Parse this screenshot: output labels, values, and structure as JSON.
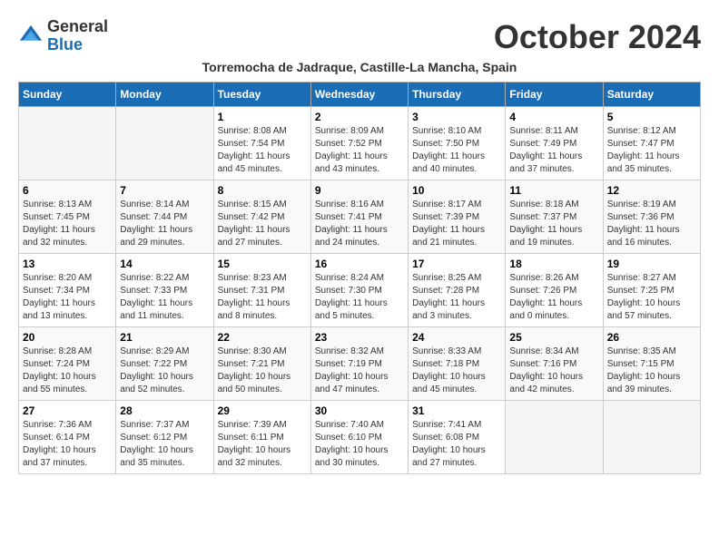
{
  "header": {
    "logo_general": "General",
    "logo_blue": "Blue",
    "month_title": "October 2024",
    "location": "Torremocha de Jadraque, Castille-La Mancha, Spain"
  },
  "weekdays": [
    "Sunday",
    "Monday",
    "Tuesday",
    "Wednesday",
    "Thursday",
    "Friday",
    "Saturday"
  ],
  "weeks": [
    [
      {
        "day": "",
        "info": ""
      },
      {
        "day": "",
        "info": ""
      },
      {
        "day": "1",
        "info": "Sunrise: 8:08 AM\nSunset: 7:54 PM\nDaylight: 11 hours and 45 minutes."
      },
      {
        "day": "2",
        "info": "Sunrise: 8:09 AM\nSunset: 7:52 PM\nDaylight: 11 hours and 43 minutes."
      },
      {
        "day": "3",
        "info": "Sunrise: 8:10 AM\nSunset: 7:50 PM\nDaylight: 11 hours and 40 minutes."
      },
      {
        "day": "4",
        "info": "Sunrise: 8:11 AM\nSunset: 7:49 PM\nDaylight: 11 hours and 37 minutes."
      },
      {
        "day": "5",
        "info": "Sunrise: 8:12 AM\nSunset: 7:47 PM\nDaylight: 11 hours and 35 minutes."
      }
    ],
    [
      {
        "day": "6",
        "info": "Sunrise: 8:13 AM\nSunset: 7:45 PM\nDaylight: 11 hours and 32 minutes."
      },
      {
        "day": "7",
        "info": "Sunrise: 8:14 AM\nSunset: 7:44 PM\nDaylight: 11 hours and 29 minutes."
      },
      {
        "day": "8",
        "info": "Sunrise: 8:15 AM\nSunset: 7:42 PM\nDaylight: 11 hours and 27 minutes."
      },
      {
        "day": "9",
        "info": "Sunrise: 8:16 AM\nSunset: 7:41 PM\nDaylight: 11 hours and 24 minutes."
      },
      {
        "day": "10",
        "info": "Sunrise: 8:17 AM\nSunset: 7:39 PM\nDaylight: 11 hours and 21 minutes."
      },
      {
        "day": "11",
        "info": "Sunrise: 8:18 AM\nSunset: 7:37 PM\nDaylight: 11 hours and 19 minutes."
      },
      {
        "day": "12",
        "info": "Sunrise: 8:19 AM\nSunset: 7:36 PM\nDaylight: 11 hours and 16 minutes."
      }
    ],
    [
      {
        "day": "13",
        "info": "Sunrise: 8:20 AM\nSunset: 7:34 PM\nDaylight: 11 hours and 13 minutes."
      },
      {
        "day": "14",
        "info": "Sunrise: 8:22 AM\nSunset: 7:33 PM\nDaylight: 11 hours and 11 minutes."
      },
      {
        "day": "15",
        "info": "Sunrise: 8:23 AM\nSunset: 7:31 PM\nDaylight: 11 hours and 8 minutes."
      },
      {
        "day": "16",
        "info": "Sunrise: 8:24 AM\nSunset: 7:30 PM\nDaylight: 11 hours and 5 minutes."
      },
      {
        "day": "17",
        "info": "Sunrise: 8:25 AM\nSunset: 7:28 PM\nDaylight: 11 hours and 3 minutes."
      },
      {
        "day": "18",
        "info": "Sunrise: 8:26 AM\nSunset: 7:26 PM\nDaylight: 11 hours and 0 minutes."
      },
      {
        "day": "19",
        "info": "Sunrise: 8:27 AM\nSunset: 7:25 PM\nDaylight: 10 hours and 57 minutes."
      }
    ],
    [
      {
        "day": "20",
        "info": "Sunrise: 8:28 AM\nSunset: 7:24 PM\nDaylight: 10 hours and 55 minutes."
      },
      {
        "day": "21",
        "info": "Sunrise: 8:29 AM\nSunset: 7:22 PM\nDaylight: 10 hours and 52 minutes."
      },
      {
        "day": "22",
        "info": "Sunrise: 8:30 AM\nSunset: 7:21 PM\nDaylight: 10 hours and 50 minutes."
      },
      {
        "day": "23",
        "info": "Sunrise: 8:32 AM\nSunset: 7:19 PM\nDaylight: 10 hours and 47 minutes."
      },
      {
        "day": "24",
        "info": "Sunrise: 8:33 AM\nSunset: 7:18 PM\nDaylight: 10 hours and 45 minutes."
      },
      {
        "day": "25",
        "info": "Sunrise: 8:34 AM\nSunset: 7:16 PM\nDaylight: 10 hours and 42 minutes."
      },
      {
        "day": "26",
        "info": "Sunrise: 8:35 AM\nSunset: 7:15 PM\nDaylight: 10 hours and 39 minutes."
      }
    ],
    [
      {
        "day": "27",
        "info": "Sunrise: 7:36 AM\nSunset: 6:14 PM\nDaylight: 10 hours and 37 minutes."
      },
      {
        "day": "28",
        "info": "Sunrise: 7:37 AM\nSunset: 6:12 PM\nDaylight: 10 hours and 35 minutes."
      },
      {
        "day": "29",
        "info": "Sunrise: 7:39 AM\nSunset: 6:11 PM\nDaylight: 10 hours and 32 minutes."
      },
      {
        "day": "30",
        "info": "Sunrise: 7:40 AM\nSunset: 6:10 PM\nDaylight: 10 hours and 30 minutes."
      },
      {
        "day": "31",
        "info": "Sunrise: 7:41 AM\nSunset: 6:08 PM\nDaylight: 10 hours and 27 minutes."
      },
      {
        "day": "",
        "info": ""
      },
      {
        "day": "",
        "info": ""
      }
    ]
  ]
}
